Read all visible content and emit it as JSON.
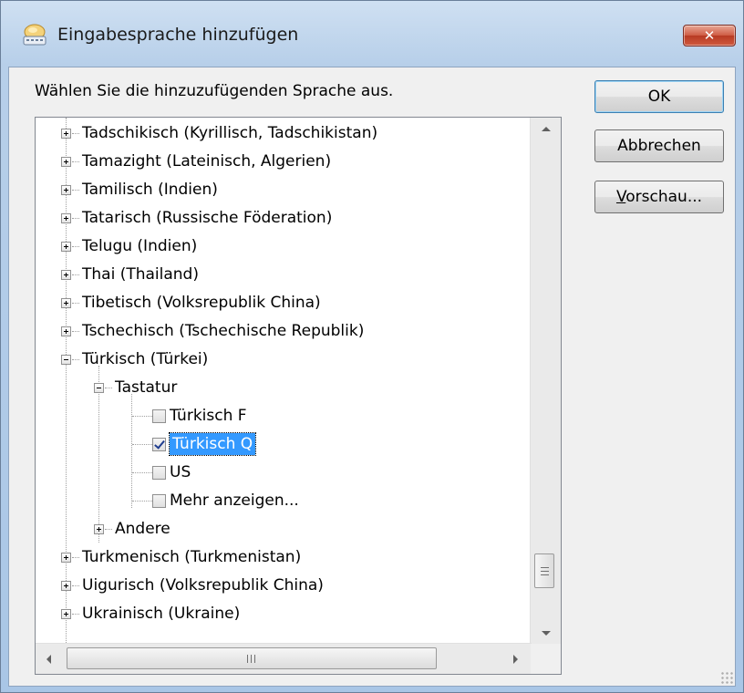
{
  "window": {
    "title": "Eingabesprache hinzufügen",
    "close_symbol": "✕",
    "accent_color": "#c7503a"
  },
  "dialog": {
    "prompt": "Wählen Sie die hinzuzufügenden Sprache aus.",
    "buttons": {
      "ok": "OK",
      "cancel": "Abbrechen",
      "preview_mnemonic": "V",
      "preview_rest": "orschau..."
    }
  },
  "tree": {
    "items_before": [
      "Tadschikisch (Kyrillisch, Tadschikistan)",
      "Tamazight (Lateinisch, Algerien)",
      "Tamilisch (Indien)",
      "Tatarisch (Russische Föderation)",
      "Telugu (Indien)",
      "Thai (Thailand)",
      "Tibetisch (Volksrepublik China)",
      "Tschechisch (Tschechische Republik)"
    ],
    "expanded_language": "Türkisch (Türkei)",
    "keyboard_group": "Tastatur",
    "keyboards": [
      {
        "label": "Türkisch F",
        "checked": false
      },
      {
        "label": "Türkisch Q",
        "checked": true,
        "selected": true
      },
      {
        "label": "US",
        "checked": false
      },
      {
        "label": "Mehr anzeigen...",
        "checked": false
      }
    ],
    "other_group": "Andere",
    "items_after": [
      "Turkmenisch (Turkmenistan)",
      "Uigurisch (Volksrepublik China)",
      "Ukrainisch (Ukraine)"
    ],
    "expander_icons": {
      "collapsed": "plus-box-icon",
      "expanded": "minus-box-icon"
    },
    "selection_color": "#3399ff"
  },
  "scrollbars": {
    "hthumb_grip": "III"
  }
}
